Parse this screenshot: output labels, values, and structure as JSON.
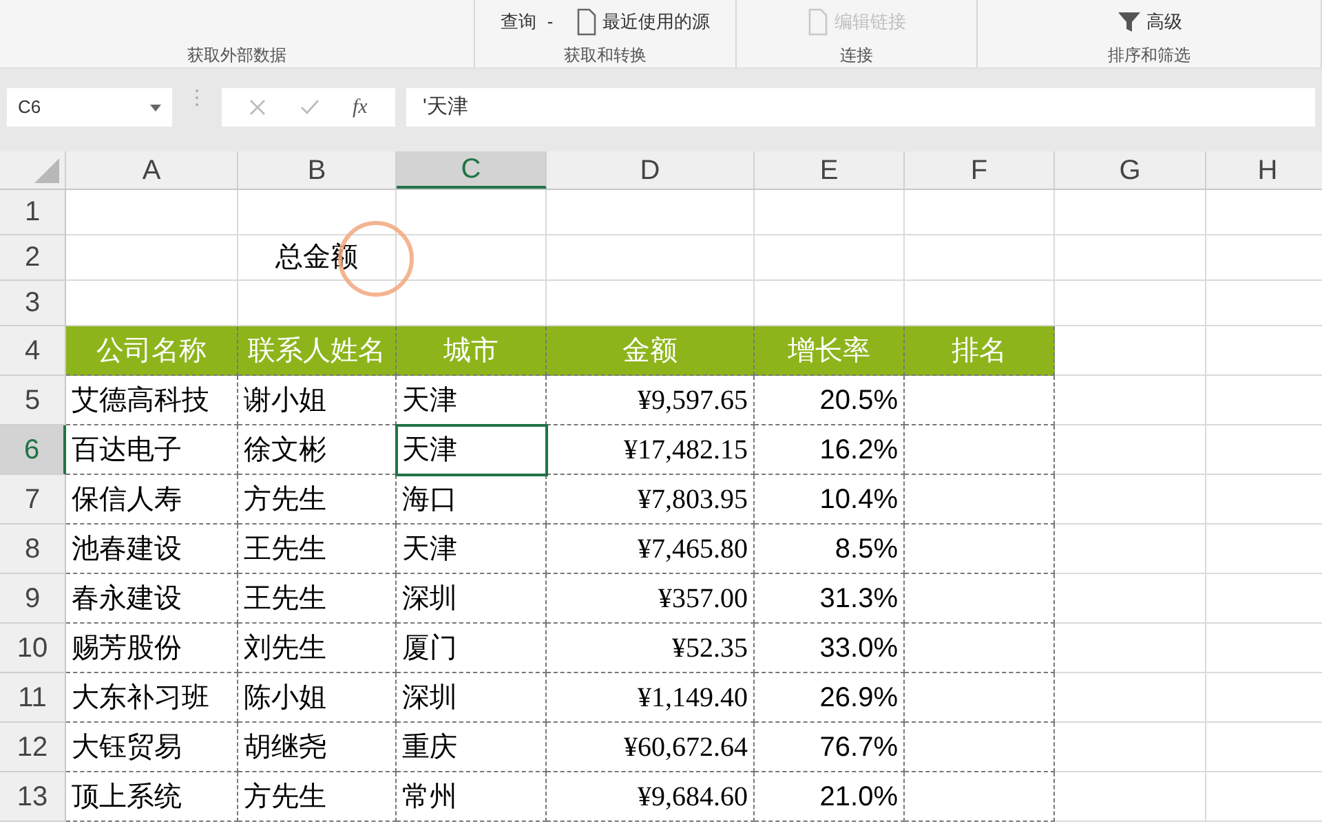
{
  "ribbon": {
    "groups": [
      {
        "label": "获取外部数据"
      },
      {
        "label": "获取和转换",
        "items": [
          {
            "kind": "dropdown",
            "label": "查询",
            "caret": "-",
            "disabled": false
          },
          {
            "kind": "file",
            "label": "最近使用的源",
            "disabled": false
          }
        ]
      },
      {
        "label": "连接",
        "items": [
          {
            "kind": "file",
            "label": "编辑链接",
            "disabled": true
          }
        ]
      },
      {
        "label": "排序和筛选",
        "items": [
          {
            "kind": "filter",
            "label": "高级",
            "disabled": false
          }
        ]
      }
    ]
  },
  "formula_bar": {
    "name_box": "C6",
    "fx": "fx",
    "formula": "'天津"
  },
  "sheet": {
    "columns": [
      {
        "label": "A",
        "selected": false
      },
      {
        "label": "B",
        "selected": false
      },
      {
        "label": "C",
        "selected": true
      },
      {
        "label": "D",
        "selected": false
      },
      {
        "label": "E",
        "selected": false
      },
      {
        "label": "F",
        "selected": false
      },
      {
        "label": "G",
        "selected": false
      },
      {
        "label": "H",
        "selected": false
      }
    ],
    "rows": [
      {
        "number": "1",
        "kind": "plain",
        "selected": false,
        "circled": false,
        "cells": []
      },
      {
        "number": "2",
        "kind": "title",
        "selected": false,
        "circled": true,
        "cells": [
          "",
          "总金额"
        ]
      },
      {
        "number": "3",
        "kind": "plain",
        "selected": false,
        "circled": false,
        "cells": []
      },
      {
        "number": "4",
        "kind": "header",
        "selected": false,
        "circled": false,
        "cells": [
          "公司名称",
          "联系人姓名",
          "城市",
          "金额",
          "增长率",
          "排名"
        ]
      },
      {
        "number": "5",
        "kind": "data",
        "selected": false,
        "circled": false,
        "cells": [
          "艾德高科技",
          "谢小姐",
          "天津",
          "¥9,597.65",
          "20.5%",
          ""
        ]
      },
      {
        "number": "6",
        "kind": "data",
        "selected": true,
        "circled": false,
        "cells": [
          "百达电子",
          "徐文彬",
          "天津",
          "¥17,482.15",
          "16.2%",
          ""
        ]
      },
      {
        "number": "7",
        "kind": "data",
        "selected": false,
        "circled": false,
        "cells": [
          "保信人寿",
          "方先生",
          "海口",
          "¥7,803.95",
          "10.4%",
          ""
        ]
      },
      {
        "number": "8",
        "kind": "data",
        "selected": false,
        "circled": false,
        "cells": [
          "池春建设",
          "王先生",
          "天津",
          "¥7,465.80",
          "8.5%",
          ""
        ]
      },
      {
        "number": "9",
        "kind": "data",
        "selected": false,
        "circled": false,
        "cells": [
          "春永建设",
          "王先生",
          "深圳",
          "¥357.00",
          "31.3%",
          ""
        ]
      },
      {
        "number": "10",
        "kind": "data",
        "selected": false,
        "circled": false,
        "cells": [
          "赐芳股份",
          "刘先生",
          "厦门",
          "¥52.35",
          "33.0%",
          ""
        ]
      },
      {
        "number": "11",
        "kind": "data",
        "selected": false,
        "circled": false,
        "cells": [
          "大东补习班",
          "陈小姐",
          "深圳",
          "¥1,149.40",
          "26.9%",
          ""
        ]
      },
      {
        "number": "12",
        "kind": "data",
        "selected": false,
        "circled": false,
        "cells": [
          "大钰贸易",
          "胡继尧",
          "重庆",
          "¥60,672.64",
          "76.7%",
          ""
        ]
      },
      {
        "number": "13",
        "kind": "data",
        "selected": false,
        "circled": false,
        "cells": [
          "顶上系统",
          "方先生",
          "常州",
          "¥9,684.60",
          "21.0%",
          ""
        ]
      }
    ]
  }
}
